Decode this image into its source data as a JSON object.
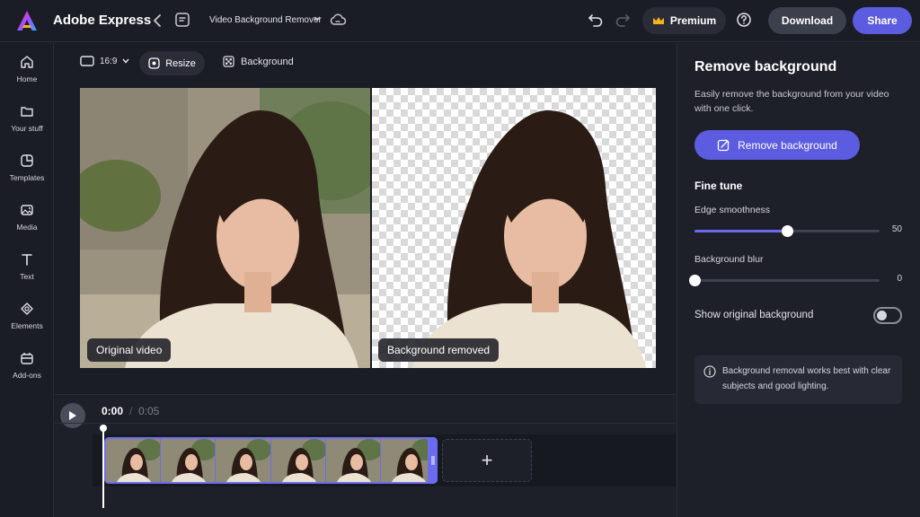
{
  "header": {
    "app_title": "Adobe Express",
    "doc_title": "Video Background Remover",
    "premium_label": "Premium",
    "download_label": "Download",
    "share_label": "Share"
  },
  "rail": {
    "items": [
      {
        "label": "Home",
        "icon": "home-icon"
      },
      {
        "label": "Your stuff",
        "icon": "folder-icon"
      },
      {
        "label": "Templates",
        "icon": "templates-icon"
      },
      {
        "label": "Media",
        "icon": "media-icon"
      },
      {
        "label": "Text",
        "icon": "text-icon"
      },
      {
        "label": "Elements",
        "icon": "elements-icon"
      },
      {
        "label": "Add-ons",
        "icon": "addons-icon"
      }
    ]
  },
  "toolbar": {
    "ratio_label": "16:9",
    "resize_label": "Resize",
    "background_label": "Background"
  },
  "preview": {
    "original_label": "Original video",
    "removed_label": "Background removed"
  },
  "timeline": {
    "current_time": "0:00",
    "separator": "/",
    "total_time": "0:05",
    "add_label": "+"
  },
  "panel": {
    "title": "Remove background",
    "description": "Easily remove the background from your video with one click.",
    "remove_button_label": "Remove background",
    "fine_tune_heading": "Fine tune",
    "edge_smoothness": {
      "label": "Edge smoothness",
      "value": "50",
      "fraction": 0.5
    },
    "background_blur": {
      "label": "Background blur",
      "value": "0",
      "fraction": 0
    },
    "show_original_label": "Show original background",
    "show_original_on": false,
    "info_text": "Background removal works best with clear subjects and good lighting."
  },
  "colors": {
    "accent": "#5c5ce0",
    "background": "#1b1d26",
    "panel": "#1e2029"
  }
}
